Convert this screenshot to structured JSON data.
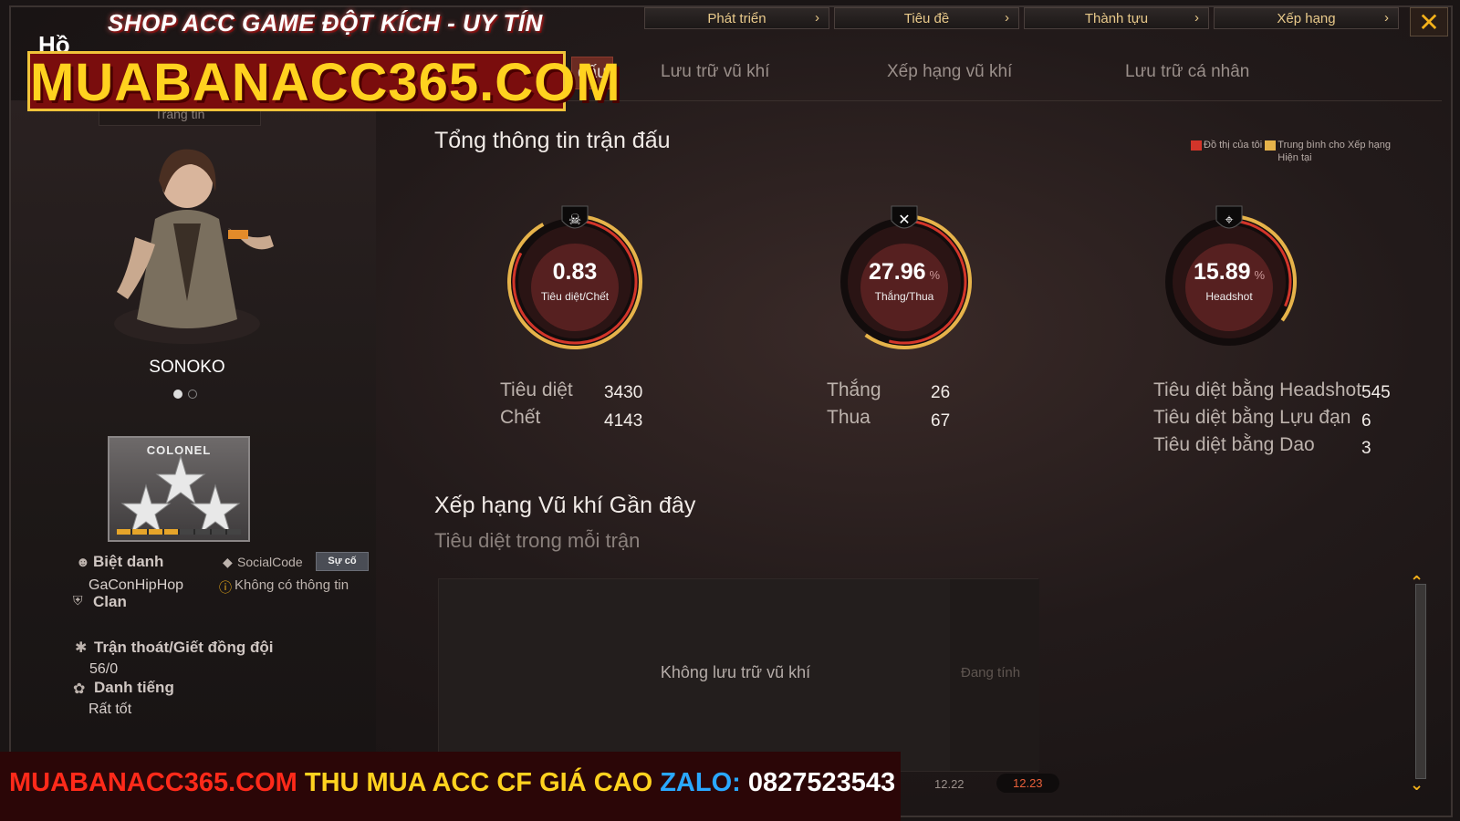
{
  "top_menu": [
    {
      "label": "Phát triển"
    },
    {
      "label": "Tiêu đề"
    },
    {
      "label": "Thành tựu"
    },
    {
      "label": "Xếp hạng"
    }
  ],
  "close_glyph": "✕",
  "tabs": [
    {
      "label": "đấu"
    },
    {
      "label": "Lưu trữ vũ khí"
    },
    {
      "label": "Xếp hạng vũ khí"
    },
    {
      "label": "Lưu trữ cá nhân"
    }
  ],
  "left": {
    "tag": "Trang tin",
    "character_name": "SONOKO",
    "rank_title": "COLONEL",
    "rank_progress": 0.45,
    "nickname_label": "Biệt danh",
    "nickname_value": "GaConHipHop",
    "socialcode_label": "SocialCode",
    "socialcode_button": "Sự cố",
    "socialcode_value": "Không có thông tin",
    "clan_label": "Clan",
    "escape_label": "Trận thoát/Giết đồng đội",
    "escape_value": "56/0",
    "reputation_label": "Danh tiếng",
    "reputation_value": "Rất tốt"
  },
  "main": {
    "title": "Tổng thông tin trận đấu",
    "legend_mine": "Đồ thị của tôi",
    "legend_avg": "Trung bình cho Xếp hạng Hiện tại",
    "gauges": [
      {
        "value": "0.83",
        "unit": "",
        "label": "Tiêu diệt/Chết",
        "fill": 0.92
      },
      {
        "value": "27.96",
        "unit": "%",
        "label": "Thắng/Thua",
        "fill": 0.6
      },
      {
        "value": "15.89",
        "unit": "%",
        "label": "Headshot",
        "fill": 0.35
      }
    ],
    "stats_kd": [
      {
        "label": "Tiêu diệt",
        "value": "3430"
      },
      {
        "label": "Chết",
        "value": "4143"
      }
    ],
    "stats_wl": [
      {
        "label": "Thắng",
        "value": "26"
      },
      {
        "label": "Thua",
        "value": "67"
      }
    ],
    "stats_hs": [
      {
        "label": "Tiêu diệt bằng Headshot",
        "value": "545"
      },
      {
        "label": "Tiêu diệt bằng Lựu đạn",
        "value": "6"
      },
      {
        "label": "Tiêu diệt bằng Dao",
        "value": "3"
      }
    ],
    "weapon_title": "Xếp hạng Vũ khí Gần đây",
    "weapon_subtitle": "Tiêu diệt trong mỗi trận",
    "weapon_empty": "Không lưu trữ vũ khí",
    "weapon_pending": "Đang tính",
    "dates": [
      "12.22",
      "12.23"
    ]
  },
  "overlay": {
    "top_text": "SHOP ACC GAME ĐỘT KÍCH - UY TÍN",
    "site": "MUABANACC365.COM",
    "he": "Hồ",
    "ad_site": "MUABANACC365.COM",
    "ad_text": "THU MUA ACC CF GIÁ CAO",
    "ad_zalo": "ZALO:",
    "ad_phone": "0827523543"
  },
  "colors": {
    "gauge_ring": "#e6b34a",
    "gauge_red": "#d2352a",
    "ad_red": "#ff2a1a",
    "ad_yellow": "#ffd21f",
    "ad_blue": "#2aa8ff"
  }
}
